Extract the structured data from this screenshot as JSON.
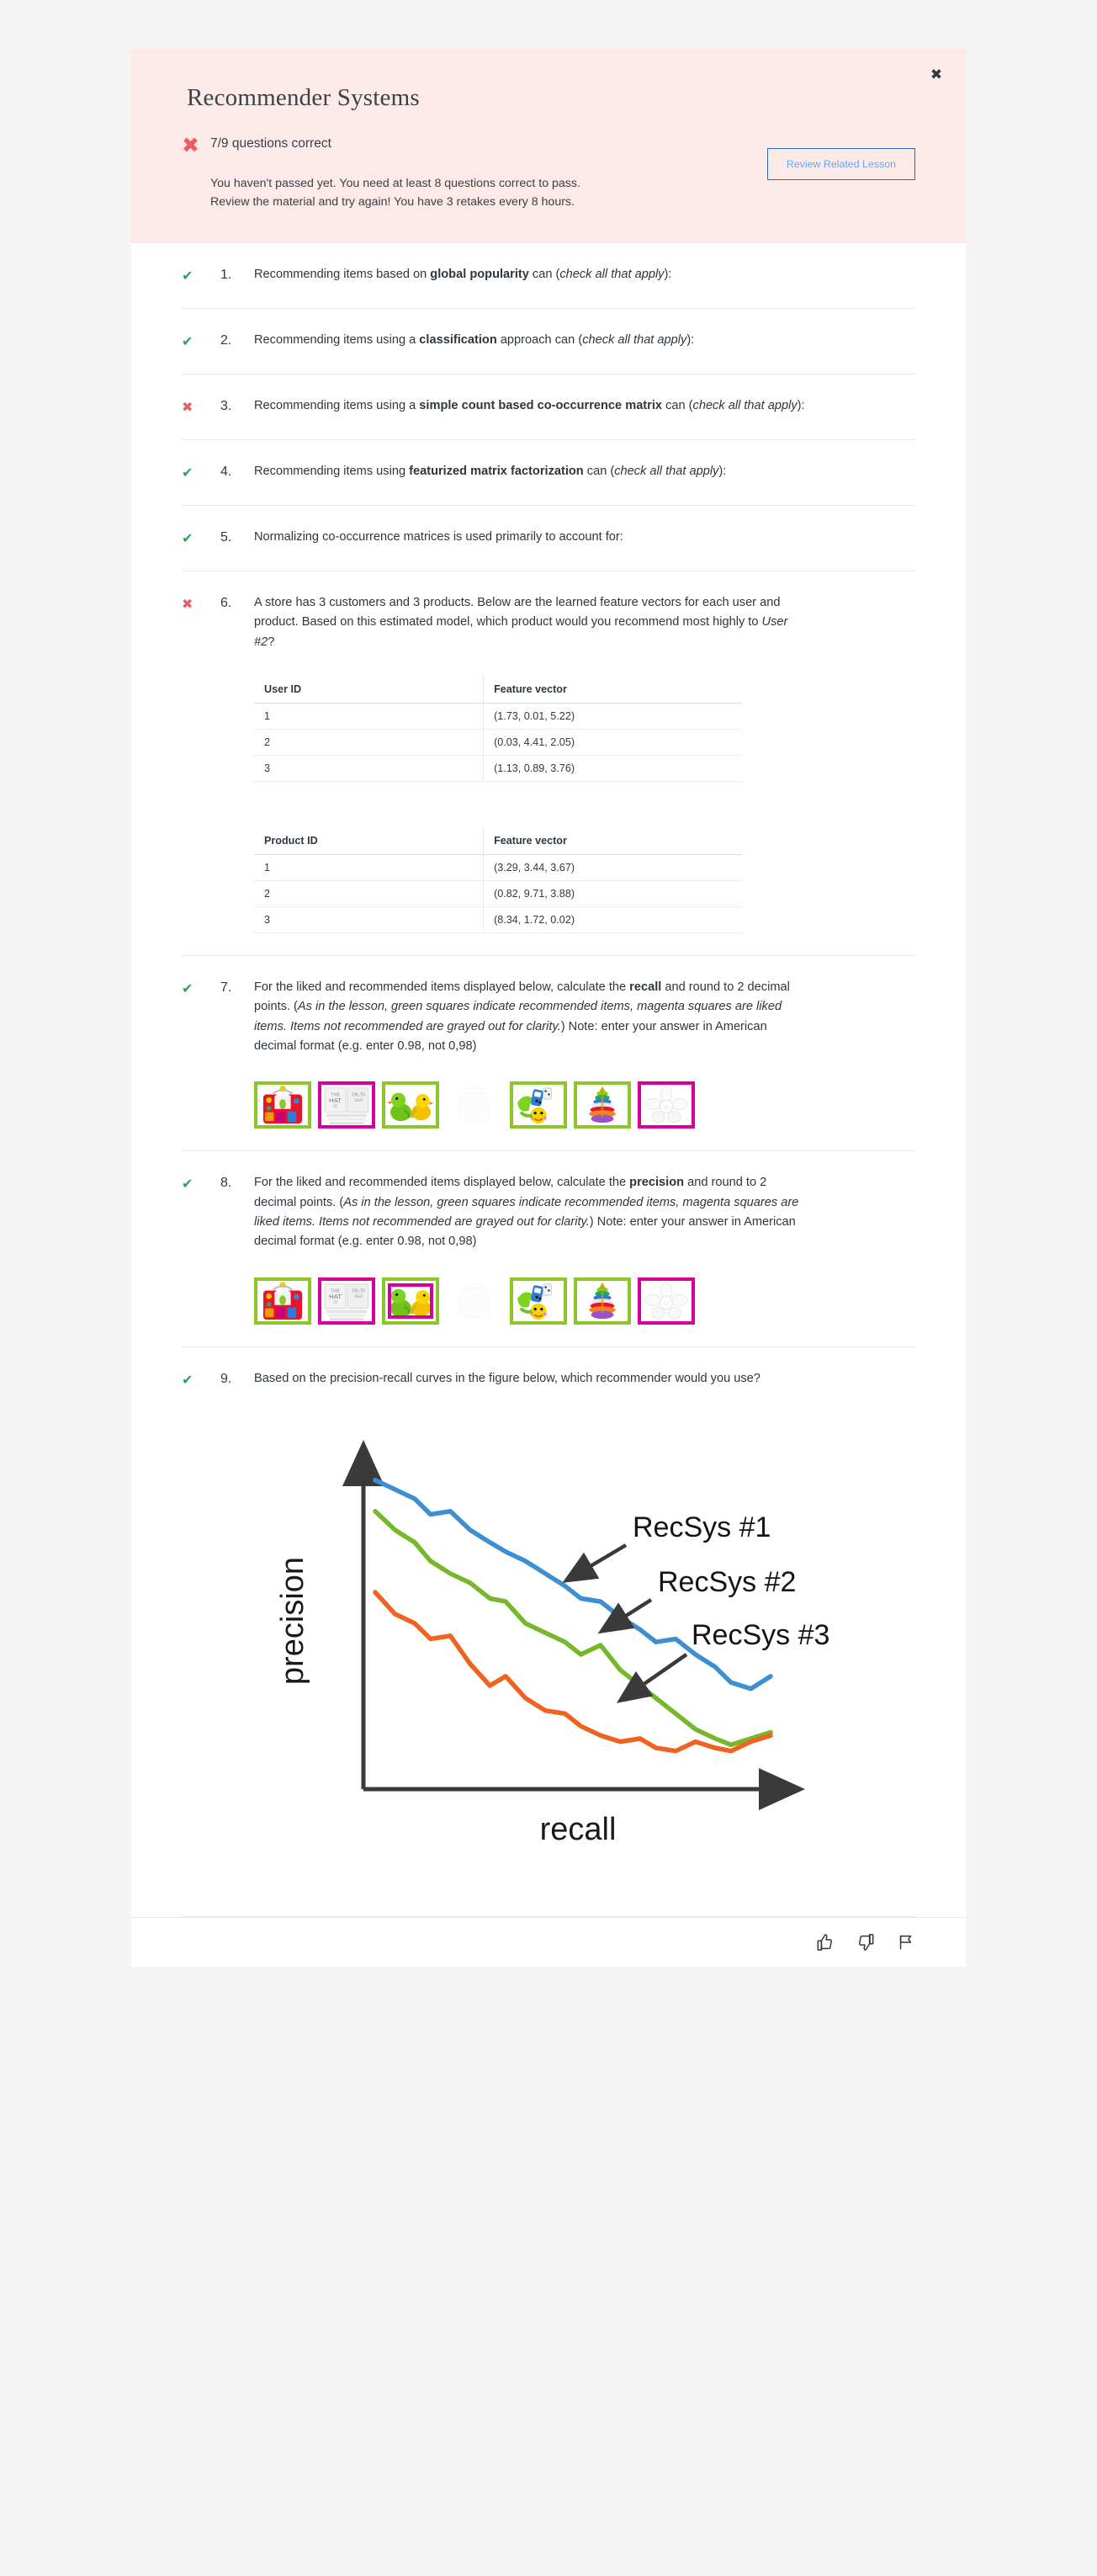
{
  "header": {
    "title": "Recommender Systems",
    "close_label": "✖",
    "score_mark": "✖",
    "score_text": "7/9 questions correct",
    "message_line1": "You haven't passed yet. You need at least 8 questions correct to pass.",
    "message_line2": "Review the material and try again! You have 3 retakes every 8 hours.",
    "review_button": "Review Related Lesson",
    "banner_bg": "#fce9e8",
    "fail_color": "#f05b63",
    "button_border_color": "#2b6cb8",
    "button_text_color": "#68a8e8"
  },
  "marks": {
    "correct": "✔",
    "wrong": "✖"
  },
  "colors": {
    "correct": "#2aa45f",
    "wrong": "#f05b63",
    "recommended_green": "#8cc62b",
    "liked_magenta": "#d5009c"
  },
  "questions": [
    {
      "number": "1.",
      "status": "correct",
      "text_html": "Recommending items based on <b>global popularity</b> can (<i>check all that apply</i>):"
    },
    {
      "number": "2.",
      "status": "correct",
      "text_html": "Recommending items using a <b>classification</b> approach can (<i>check all that apply</i>):"
    },
    {
      "number": "3.",
      "status": "wrong",
      "text_html": "Recommending items using a <b>simple count based co-occurrence matrix</b> can (<i>check all that apply</i>):"
    },
    {
      "number": "4.",
      "status": "correct",
      "text_html": "Recommending items using <b>featurized matrix factorization</b> can (<i>check all that apply</i>):"
    },
    {
      "number": "5.",
      "status": "correct",
      "text_html": "Normalizing co-occurrence matrices is used primarily to account for:"
    },
    {
      "number": "6.",
      "status": "wrong",
      "text_html": "A store has 3 customers and 3 products. Below are the learned feature vectors for each user and product. Based on this estimated model, which product would you recommend most highly to <i>User #2</i>?"
    },
    {
      "number": "7.",
      "status": "correct",
      "text_html": "For the liked and recommended items displayed below, calculate the <b>recall</b> and round to 2 decimal points. (<i>As in the lesson, green squares indicate recommended items, magenta squares are liked items. Items not recommended are grayed out for clarity.</i>) Note: enter your answer in American decimal format (e.g. enter 0.98, not 0,98)"
    },
    {
      "number": "8.",
      "status": "correct",
      "text_html": "For the liked and recommended items displayed below, calculate the <b>precision</b> and round to 2 decimal points. (<i>As in the lesson, green squares indicate recommended items, magenta squares are liked items. Items not recommended are grayed out for clarity.</i>) Note: enter your answer in American decimal format (e.g. enter 0.98, not 0,98)"
    },
    {
      "number": "9.",
      "status": "correct",
      "text_html": "Based on the precision-recall curves in the figure below, which recommender would you use?"
    }
  ],
  "user_table": {
    "headers": [
      "User ID",
      "Feature vector"
    ],
    "rows": [
      [
        "1",
        "(1.73, 0.01, 5.22)"
      ],
      [
        "2",
        "(0.03, 4.41, 2.05)"
      ],
      [
        "3",
        "(1.13, 0.89, 3.76)"
      ]
    ]
  },
  "product_table": {
    "headers": [
      "Product ID",
      "Feature vector"
    ],
    "rows": [
      [
        "1",
        "(3.29, 3.44, 3.67)"
      ],
      [
        "2",
        "(0.82, 9.71, 3.88)"
      ],
      [
        "3",
        "(8.34, 1.72, 0.02)"
      ]
    ]
  },
  "q7_items": [
    {
      "item": "activity-house-toy",
      "border": "green"
    },
    {
      "item": "book-stack",
      "border": "magenta"
    },
    {
      "item": "rubber-ducks",
      "border": "green"
    },
    {
      "item": "teething-toy",
      "border": "none"
    },
    {
      "item": "caterpillar-toy",
      "border": "green"
    },
    {
      "item": "ring-stacker",
      "border": "green"
    },
    {
      "item": "flower-rattle",
      "border": "magenta"
    }
  ],
  "q8_items": [
    {
      "item": "activity-house-toy",
      "border": "green"
    },
    {
      "item": "book-stack",
      "border": "magenta"
    },
    {
      "item": "rubber-ducks",
      "border": "double"
    },
    {
      "item": "teething-toy",
      "border": "none"
    },
    {
      "item": "caterpillar-toy",
      "border": "green"
    },
    {
      "item": "ring-stacker",
      "border": "green"
    },
    {
      "item": "flower-rattle",
      "border": "magenta"
    }
  ],
  "chart_data": {
    "type": "line",
    "title": "",
    "xlabel": "recall",
    "ylabel": "precision",
    "grid": false,
    "legend_position": "inline-annotations",
    "xlim": [
      0,
      1
    ],
    "ylim": [
      0,
      1
    ],
    "annotations": [
      "RecSys #1",
      "RecSys #2",
      "RecSys #3"
    ],
    "series": [
      {
        "name": "RecSys #1",
        "color": "#3d8fd1",
        "x": [
          0.0,
          0.05,
          0.1,
          0.14,
          0.19,
          0.24,
          0.29,
          0.33,
          0.38,
          0.43,
          0.48,
          0.52,
          0.57,
          0.62,
          0.67,
          0.71,
          0.76,
          0.81,
          0.86,
          0.9,
          0.95,
          1.0
        ],
        "y": [
          0.96,
          0.93,
          0.9,
          0.85,
          0.86,
          0.8,
          0.76,
          0.73,
          0.7,
          0.66,
          0.62,
          0.58,
          0.57,
          0.52,
          0.48,
          0.44,
          0.45,
          0.4,
          0.36,
          0.31,
          0.29,
          0.33
        ]
      },
      {
        "name": "RecSys #2",
        "color": "#76b82a",
        "x": [
          0.0,
          0.05,
          0.1,
          0.14,
          0.19,
          0.24,
          0.29,
          0.33,
          0.38,
          0.43,
          0.48,
          0.52,
          0.57,
          0.62,
          0.67,
          0.71,
          0.76,
          0.81,
          0.86,
          0.9,
          0.95,
          1.0
        ],
        "y": [
          0.86,
          0.8,
          0.76,
          0.7,
          0.66,
          0.63,
          0.58,
          0.57,
          0.5,
          0.47,
          0.44,
          0.4,
          0.43,
          0.35,
          0.3,
          0.26,
          0.21,
          0.16,
          0.13,
          0.11,
          0.13,
          0.15
        ]
      },
      {
        "name": "RecSys #3",
        "color": "#f0621f",
        "x": [
          0.0,
          0.05,
          0.1,
          0.14,
          0.19,
          0.24,
          0.29,
          0.33,
          0.38,
          0.43,
          0.48,
          0.52,
          0.57,
          0.62,
          0.67,
          0.71,
          0.76,
          0.81,
          0.86,
          0.9,
          0.95,
          1.0
        ],
        "y": [
          0.6,
          0.53,
          0.5,
          0.45,
          0.46,
          0.37,
          0.3,
          0.33,
          0.26,
          0.22,
          0.21,
          0.17,
          0.14,
          0.12,
          0.13,
          0.1,
          0.09,
          0.12,
          0.1,
          0.09,
          0.12,
          0.14
        ]
      }
    ]
  },
  "footer": {
    "like_icon": "thumbs-up-icon",
    "dislike_icon": "thumbs-down-icon",
    "flag_icon": "flag-icon"
  }
}
